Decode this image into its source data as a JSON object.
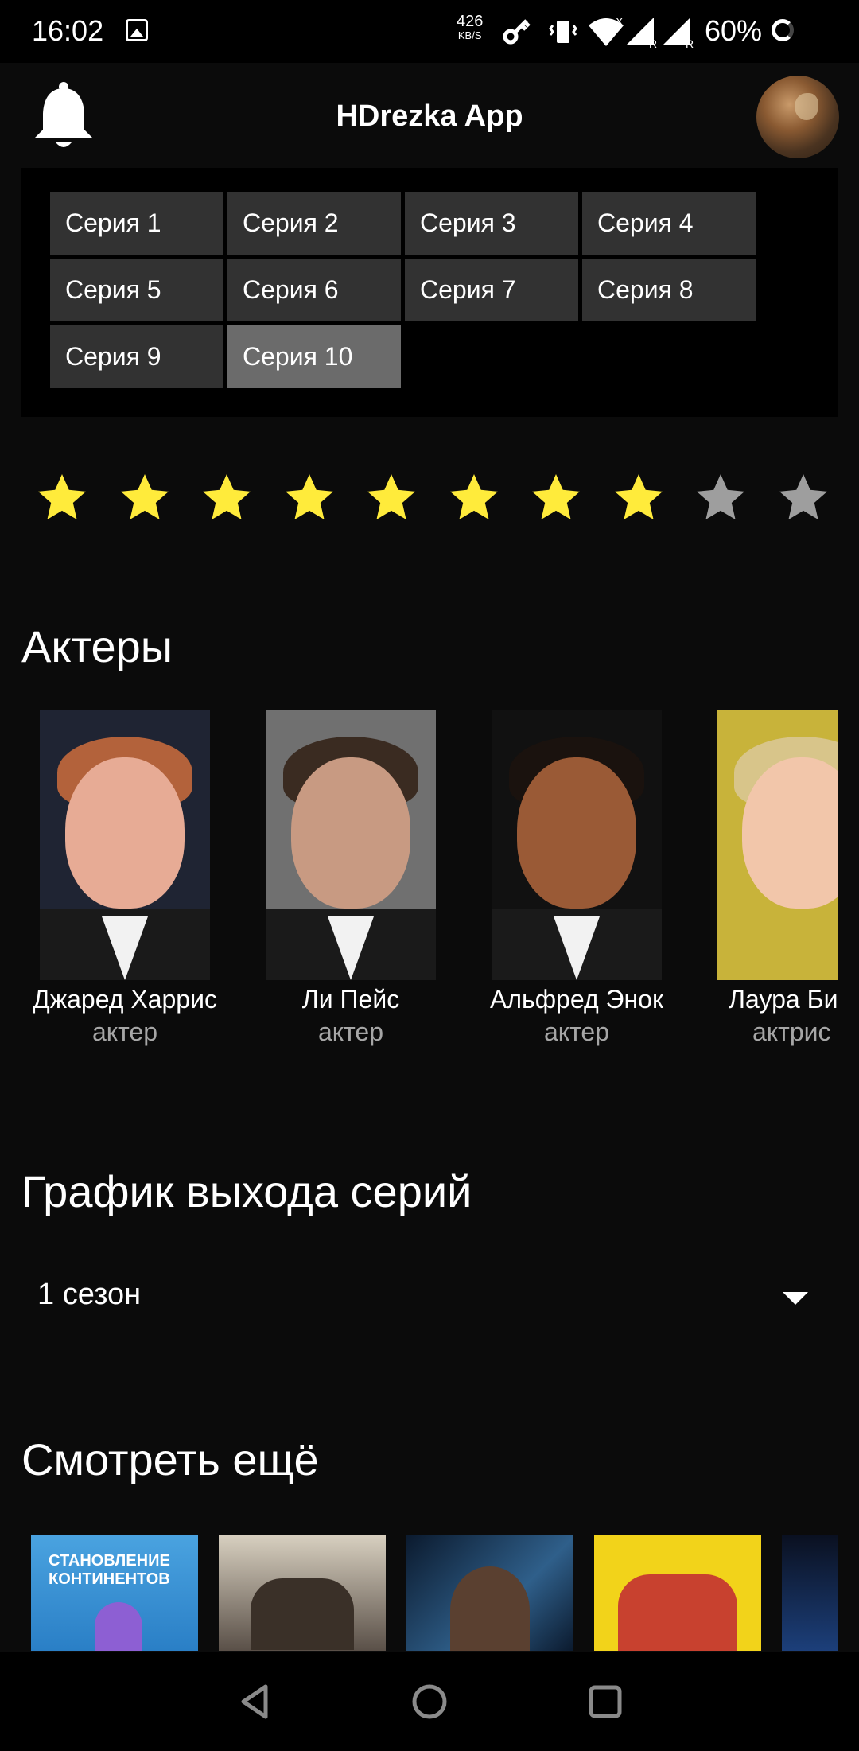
{
  "status_bar": {
    "time": "16:02",
    "speed_value": "426",
    "speed_unit": "KB/S",
    "battery": "60%",
    "icons": [
      "image-icon",
      "vpn-key-icon",
      "vibrate-icon",
      "wifi-icon",
      "signal-icon",
      "signal-icon",
      "battery-ring-icon"
    ]
  },
  "app_bar": {
    "title": "HDrezka App",
    "left_icon": "bell-icon",
    "right_icon": "profile-avatar"
  },
  "episodes": {
    "items": [
      "Серия 1",
      "Серия 2",
      "Серия 3",
      "Серия 4",
      "Серия 5",
      "Серия 6",
      "Серия 7",
      "Серия 8",
      "Серия 9",
      "Серия 10"
    ],
    "selected_index": 9
  },
  "rating": {
    "filled": 8,
    "total": 10,
    "filled_color": "#ffeb3b",
    "empty_color": "#9e9e9e"
  },
  "actors_section": {
    "title": "Актеры",
    "actors": [
      {
        "name": "Джаред Харрис",
        "role": "актер"
      },
      {
        "name": "Ли Пейс",
        "role": "актер"
      },
      {
        "name": "Альфред Энок",
        "role": "актер"
      },
      {
        "name": "Лаура Би",
        "role": "актрис"
      }
    ]
  },
  "schedule_section": {
    "title": "График выхода серий",
    "season_selected": "1 сезон"
  },
  "more_section": {
    "title": "Смотреть ещё",
    "posters": [
      {
        "text": "СТАНОВЛЕНИЕ КОНТИНЕНТОВ"
      },
      {
        "text": ""
      },
      {
        "text": ""
      },
      {
        "text": ""
      },
      {
        "text": ""
      }
    ]
  },
  "nav_bar": {
    "icons": [
      "back-icon",
      "home-icon",
      "recents-icon"
    ]
  }
}
